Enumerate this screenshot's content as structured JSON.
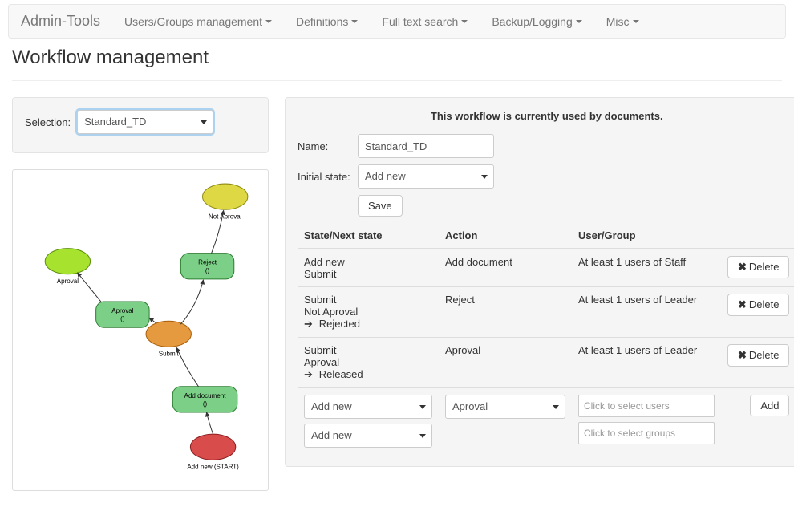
{
  "nav": {
    "brand": "Admin-Tools",
    "items": [
      "Users/Groups management",
      "Definitions",
      "Full text search",
      "Backup/Logging",
      "Misc"
    ]
  },
  "page_title": "Workflow management",
  "selection": {
    "label": "Selection:",
    "value": "Standard_TD"
  },
  "right": {
    "info": "This workflow is currently used by documents.",
    "name_label": "Name:",
    "name_value": "Standard_TD",
    "initial_label": "Initial state:",
    "initial_value": "Add new",
    "save_label": "Save"
  },
  "table": {
    "headers": {
      "state": "State/Next state",
      "action": "Action",
      "user": "User/Group",
      "empty": ""
    },
    "rows": [
      {
        "lines": [
          "Add new",
          "Submit"
        ],
        "type": null,
        "action": "Add document",
        "user": "At least 1 users of Staff",
        "delete": "Delete"
      },
      {
        "lines": [
          "Submit",
          "Not Aproval"
        ],
        "type": "Rejected",
        "action": "Reject",
        "user": "At least 1 users of Leader",
        "delete": "Delete"
      },
      {
        "lines": [
          "Submit",
          "Aproval"
        ],
        "type": "Released",
        "action": "Aproval",
        "user": "At least 1 users of Leader",
        "delete": "Delete"
      }
    ],
    "add_row": {
      "state_sel": "Add new",
      "action_sel": "Aproval",
      "next_sel": "Add new",
      "users_ph": "Click to select users",
      "groups_ph": "Click to select groups",
      "add_label": "Add"
    }
  },
  "diagram": {
    "nodes": {
      "start": {
        "label": "Add new (START)"
      },
      "not_aproval": {
        "label": "Not Aproval"
      },
      "aproval_end": {
        "label": "Aproval"
      },
      "submit": {
        "label": "Submit"
      },
      "add_doc": {
        "label": "Add document",
        "sub": "()"
      },
      "aproval": {
        "label": "Aproval",
        "sub": "()"
      },
      "reject": {
        "label": "Reject",
        "sub": "()"
      }
    }
  }
}
